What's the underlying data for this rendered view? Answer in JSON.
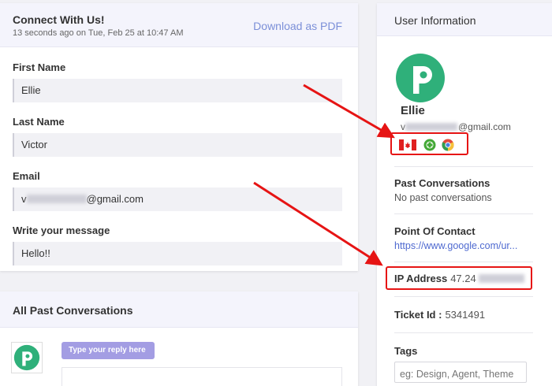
{
  "form": {
    "title": "Connect With Us!",
    "subtitle": "13 seconds ago on Tue, Feb 25 at 10:47 AM",
    "pdf_link": "Download as PDF",
    "fields": [
      {
        "label": "First Name",
        "value": "Ellie"
      },
      {
        "label": "Last Name",
        "value": "Victor"
      },
      {
        "label": "Email",
        "prefix": "v",
        "suffix": "@gmail.com"
      },
      {
        "label": "Write your message",
        "value": "Hello!!"
      }
    ]
  },
  "conversations": {
    "title": "All Past Conversations",
    "reply_label": "Type your reply here"
  },
  "user": {
    "title": "User Information",
    "name": "Ellie",
    "email_prefix": "v",
    "email_suffix": "@gmail.com",
    "badges": [
      "canada-flag-icon",
      "android-icon",
      "chrome-icon"
    ],
    "past_label": "Past Conversations",
    "past_value": "No past conversations",
    "poc_label": "Point Of Contact",
    "poc_value": "https://www.google.com/ur...",
    "ip_label": "IP Address",
    "ip_value": "47.24",
    "ticket_label": "Ticket Id :",
    "ticket_value": "5341491",
    "tags_label": "Tags",
    "tags_placeholder": "eg: Design, Agent, Theme"
  },
  "colors": {
    "accent": "#7b8fd8",
    "link": "#4f6ad0",
    "brand_green": "#2fb07a",
    "annotation_red": "#e61414",
    "reply_pill": "#a39de3"
  }
}
